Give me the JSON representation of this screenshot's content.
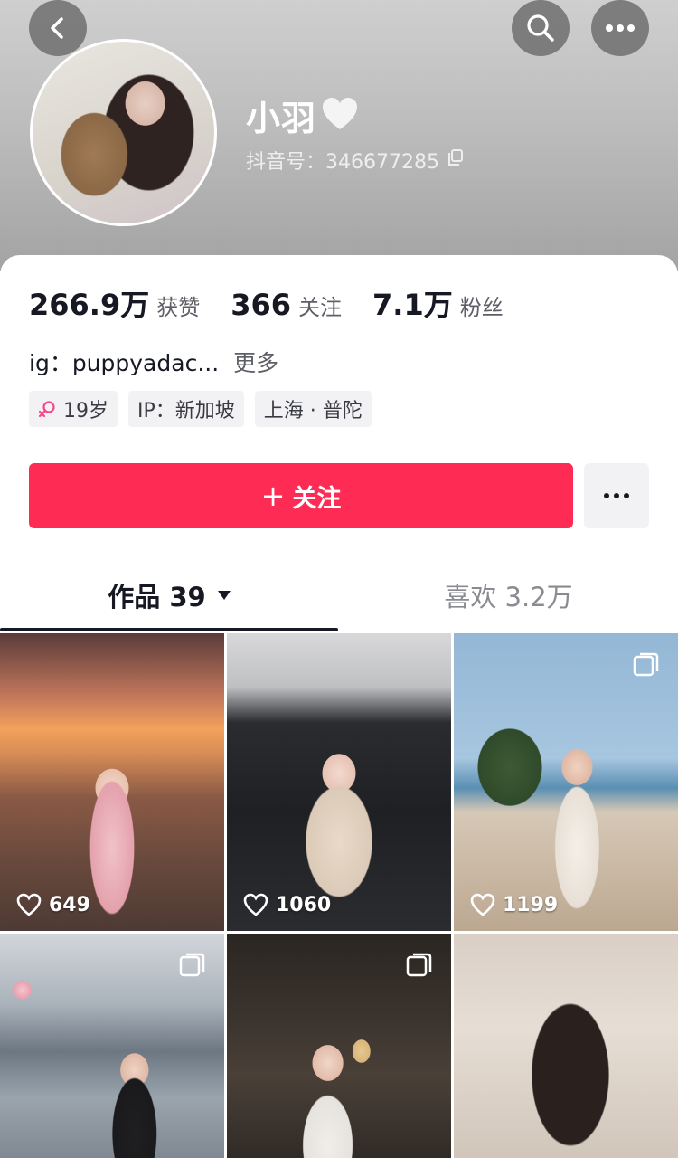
{
  "profile": {
    "name": "小羽",
    "id_label": "抖音号：346677285"
  },
  "stats": [
    {
      "value": "266.9万",
      "label": "获赞"
    },
    {
      "value": "366",
      "label": "关注"
    },
    {
      "value": "7.1万",
      "label": "粉丝"
    }
  ],
  "bio": {
    "text": "ig：puppyadac...",
    "more": "更多"
  },
  "tags": {
    "age": "19岁",
    "ip": "IP：新加坡",
    "location": "上海 · 普陀"
  },
  "actions": {
    "follow_plus": "+",
    "follow_label": "关注"
  },
  "tabs": {
    "works": "作品 39",
    "likes": "喜欢 3.2万"
  },
  "videos": [
    {
      "likes": "649"
    },
    {
      "likes": "1060"
    },
    {
      "likes": "1199"
    },
    {
      "likes": ""
    },
    {
      "likes": ""
    },
    {
      "likes": ""
    }
  ],
  "colors": {
    "accent": "#fe2c55",
    "female_icon": "#f5468a"
  },
  "icons": [
    "back-icon",
    "search-icon",
    "more-icon",
    "heart-icon",
    "copy-icon",
    "female-icon",
    "caret-down-icon",
    "like-icon",
    "multi-photo-icon"
  ]
}
